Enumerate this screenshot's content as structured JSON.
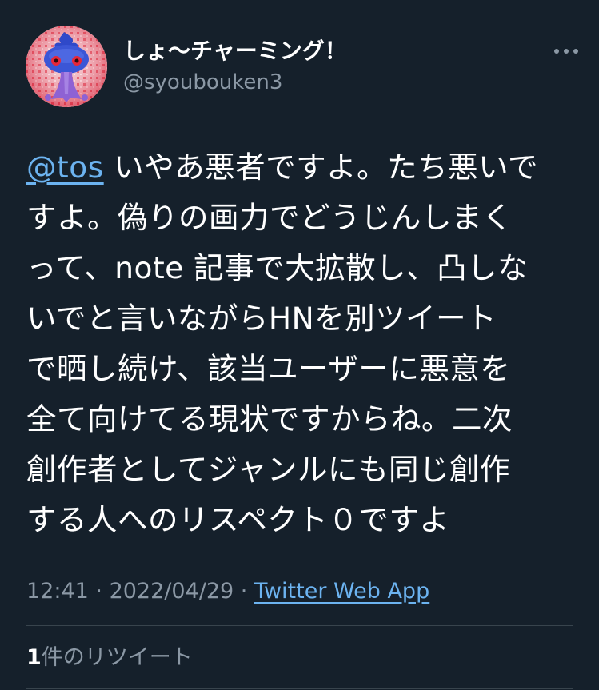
{
  "tweet": {
    "author": {
      "display_name": "しょ〜チャーミング！",
      "handle": "@syoubouken3",
      "avatar_icon": "purple-creature-avatar"
    },
    "more_icon": "more-horizontal-icon",
    "body": {
      "mention": "@tos",
      "lines": [
        " いやあ悪者ですよ。たち悪いで",
        "すよ。偽りの画力でどうじんしまく",
        "って、note 記事で大拡散し、凸しな",
        "いでと言いながらHNを別ツイート",
        "で晒し続け、該当ユーザーに悪意を",
        "全て向けてる現状ですからね。二次",
        "創作者としてジャンルにも同じ創作",
        "する人へのリスペクト０ですよ"
      ]
    },
    "meta": {
      "time": "12:41",
      "separator": " · ",
      "date": "2022/04/29",
      "source": "Twitter Web App"
    },
    "retweets": {
      "count": "1",
      "label": "件のリツイート"
    }
  },
  "colors": {
    "background": "#15202b",
    "text": "#ffffff",
    "muted": "#8b98a5",
    "link": "#6cb3f0",
    "divider": "#38444d"
  }
}
